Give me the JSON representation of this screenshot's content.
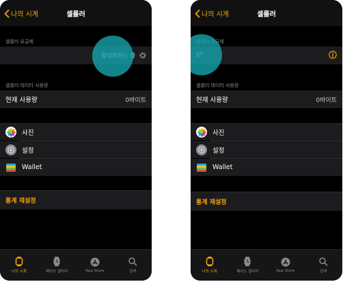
{
  "colors": {
    "accent": "#f5a30a",
    "highlight": "#14a0aa"
  },
  "left": {
    "nav": {
      "back_label": "나의 시계",
      "title": "셀룰러"
    },
    "plan_section": {
      "label": "셀룰러 요금제",
      "status": "활성화하는 중"
    },
    "usage_section": {
      "label": "셀룰러 데이터 사용량",
      "current_label": "현재 사용량",
      "current_value": "0바이트"
    },
    "apps": [
      {
        "name": "사진",
        "icon": "photos-icon"
      },
      {
        "name": "설정",
        "icon": "settings-icon"
      },
      {
        "name": "Wallet",
        "icon": "wallet-icon"
      }
    ],
    "reset_label": "통계 재설정",
    "tabs": [
      {
        "label": "나의 시계",
        "icon": "watch-icon"
      },
      {
        "label": "페이스 갤러리",
        "icon": "face-gallery-icon"
      },
      {
        "label": "App Store",
        "icon": "app-store-icon"
      },
      {
        "label": "검색",
        "icon": "search-icon"
      }
    ]
  },
  "right": {
    "nav": {
      "back_label": "나의 시계",
      "title": "셀룰러"
    },
    "plan_section": {
      "label": "셀룰러 요금제",
      "carrier": "KT"
    },
    "usage_section": {
      "label": "셀룰러 데이터 사용량",
      "current_label": "현재 사용량",
      "current_value": "0바이트"
    },
    "apps": [
      {
        "name": "사진",
        "icon": "photos-icon"
      },
      {
        "name": "설정",
        "icon": "settings-icon"
      },
      {
        "name": "Wallet",
        "icon": "wallet-icon"
      }
    ],
    "reset_label": "통계 재설정",
    "tabs": [
      {
        "label": "나의 시계",
        "icon": "watch-icon"
      },
      {
        "label": "페이스 갤러리",
        "icon": "face-gallery-icon"
      },
      {
        "label": "App Store",
        "icon": "app-store-icon"
      },
      {
        "label": "검색",
        "icon": "search-icon"
      }
    ]
  }
}
